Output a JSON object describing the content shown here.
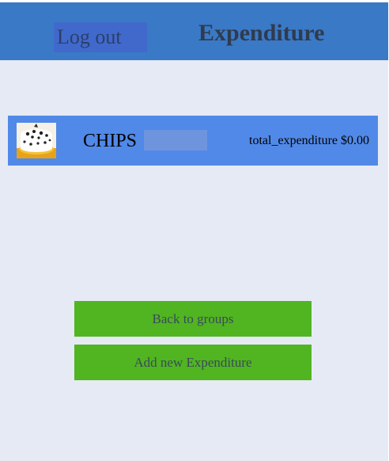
{
  "header": {
    "logout_label": "Log out",
    "title": "Expenditure"
  },
  "group": {
    "avatar_icon": "cake-icon",
    "name": "CHIPS",
    "total_label": "total_expenditure $0.00"
  },
  "actions": {
    "back_label": "Back to groups",
    "add_label": "Add new Expenditure"
  },
  "colors": {
    "header": "#3a79c6",
    "logout_bg": "#4169cc",
    "row_bg": "#5189e8",
    "button_bg": "#50b521",
    "page_bg": "#e6eaf4"
  }
}
